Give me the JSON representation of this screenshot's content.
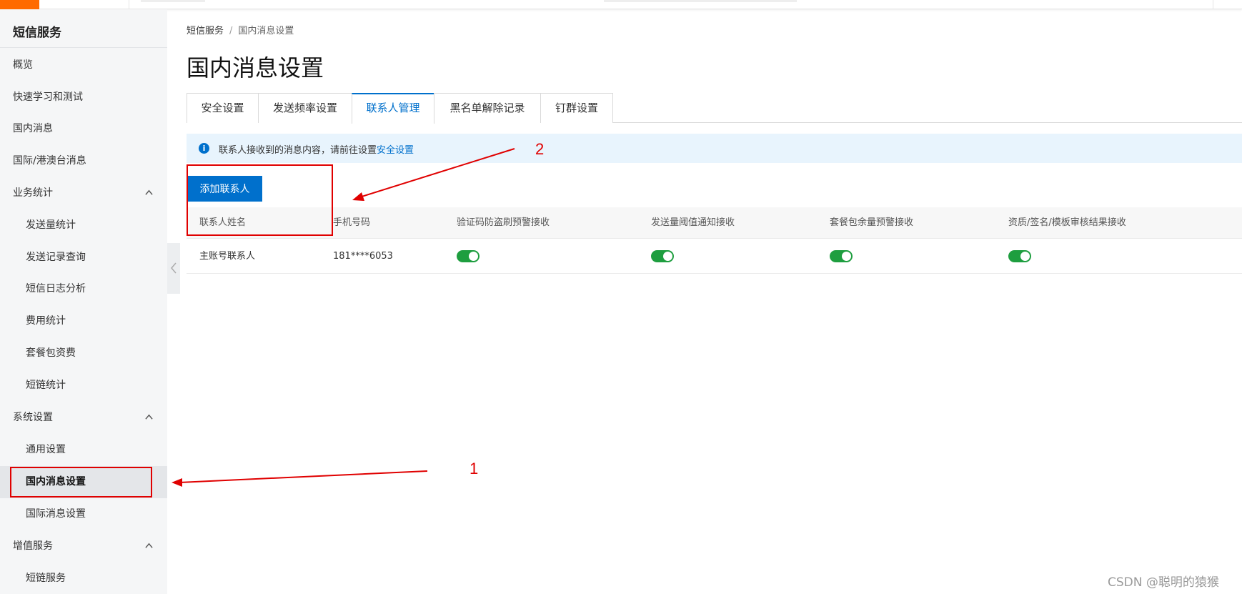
{
  "sidebar": {
    "title": "短信服务",
    "items": [
      {
        "label": "概览"
      },
      {
        "label": "快速学习和测试"
      },
      {
        "label": "国内消息"
      },
      {
        "label": "国际/港澳台消息"
      },
      {
        "label": "业务统计"
      },
      {
        "label": "发送量统计"
      },
      {
        "label": "发送记录查询"
      },
      {
        "label": "短信日志分析"
      },
      {
        "label": "费用统计"
      },
      {
        "label": "套餐包资费"
      },
      {
        "label": "短链统计"
      },
      {
        "label": "系统设置"
      },
      {
        "label": "通用设置"
      },
      {
        "label": "国内消息设置"
      },
      {
        "label": "国际消息设置"
      },
      {
        "label": "增值服务"
      },
      {
        "label": "短链服务"
      }
    ]
  },
  "breadcrumb": {
    "root": "短信服务",
    "separator": "/",
    "current": "国内消息设置"
  },
  "page": {
    "title": "国内消息设置"
  },
  "tabs": [
    {
      "label": "安全设置"
    },
    {
      "label": "发送频率设置"
    },
    {
      "label": "联系人管理",
      "active": true
    },
    {
      "label": "黑名单解除记录"
    },
    {
      "label": "钉群设置"
    }
  ],
  "notice": {
    "text": "联系人接收到的消息内容，请前往设置",
    "link": "安全设置"
  },
  "add_button": {
    "label": "添加联系人"
  },
  "table": {
    "headers": [
      "联系人姓名",
      "手机号码",
      "验证码防盗刷预警接收",
      "发送量阈值通知接收",
      "套餐包余量预警接收",
      "资质/签名/模板审核结果接收"
    ],
    "rows": [
      {
        "name": "主账号联系人",
        "phone": "181****6053",
        "toggles": [
          true,
          true,
          true,
          true
        ]
      }
    ]
  },
  "annotations": {
    "label1": "1",
    "label2": "2",
    "color": "#e00000"
  },
  "colors": {
    "primary": "#0070cc",
    "toggle_on": "#1e9e3f",
    "brand": "#ff6a00"
  },
  "watermark": "CSDN @聪明的猿猴"
}
